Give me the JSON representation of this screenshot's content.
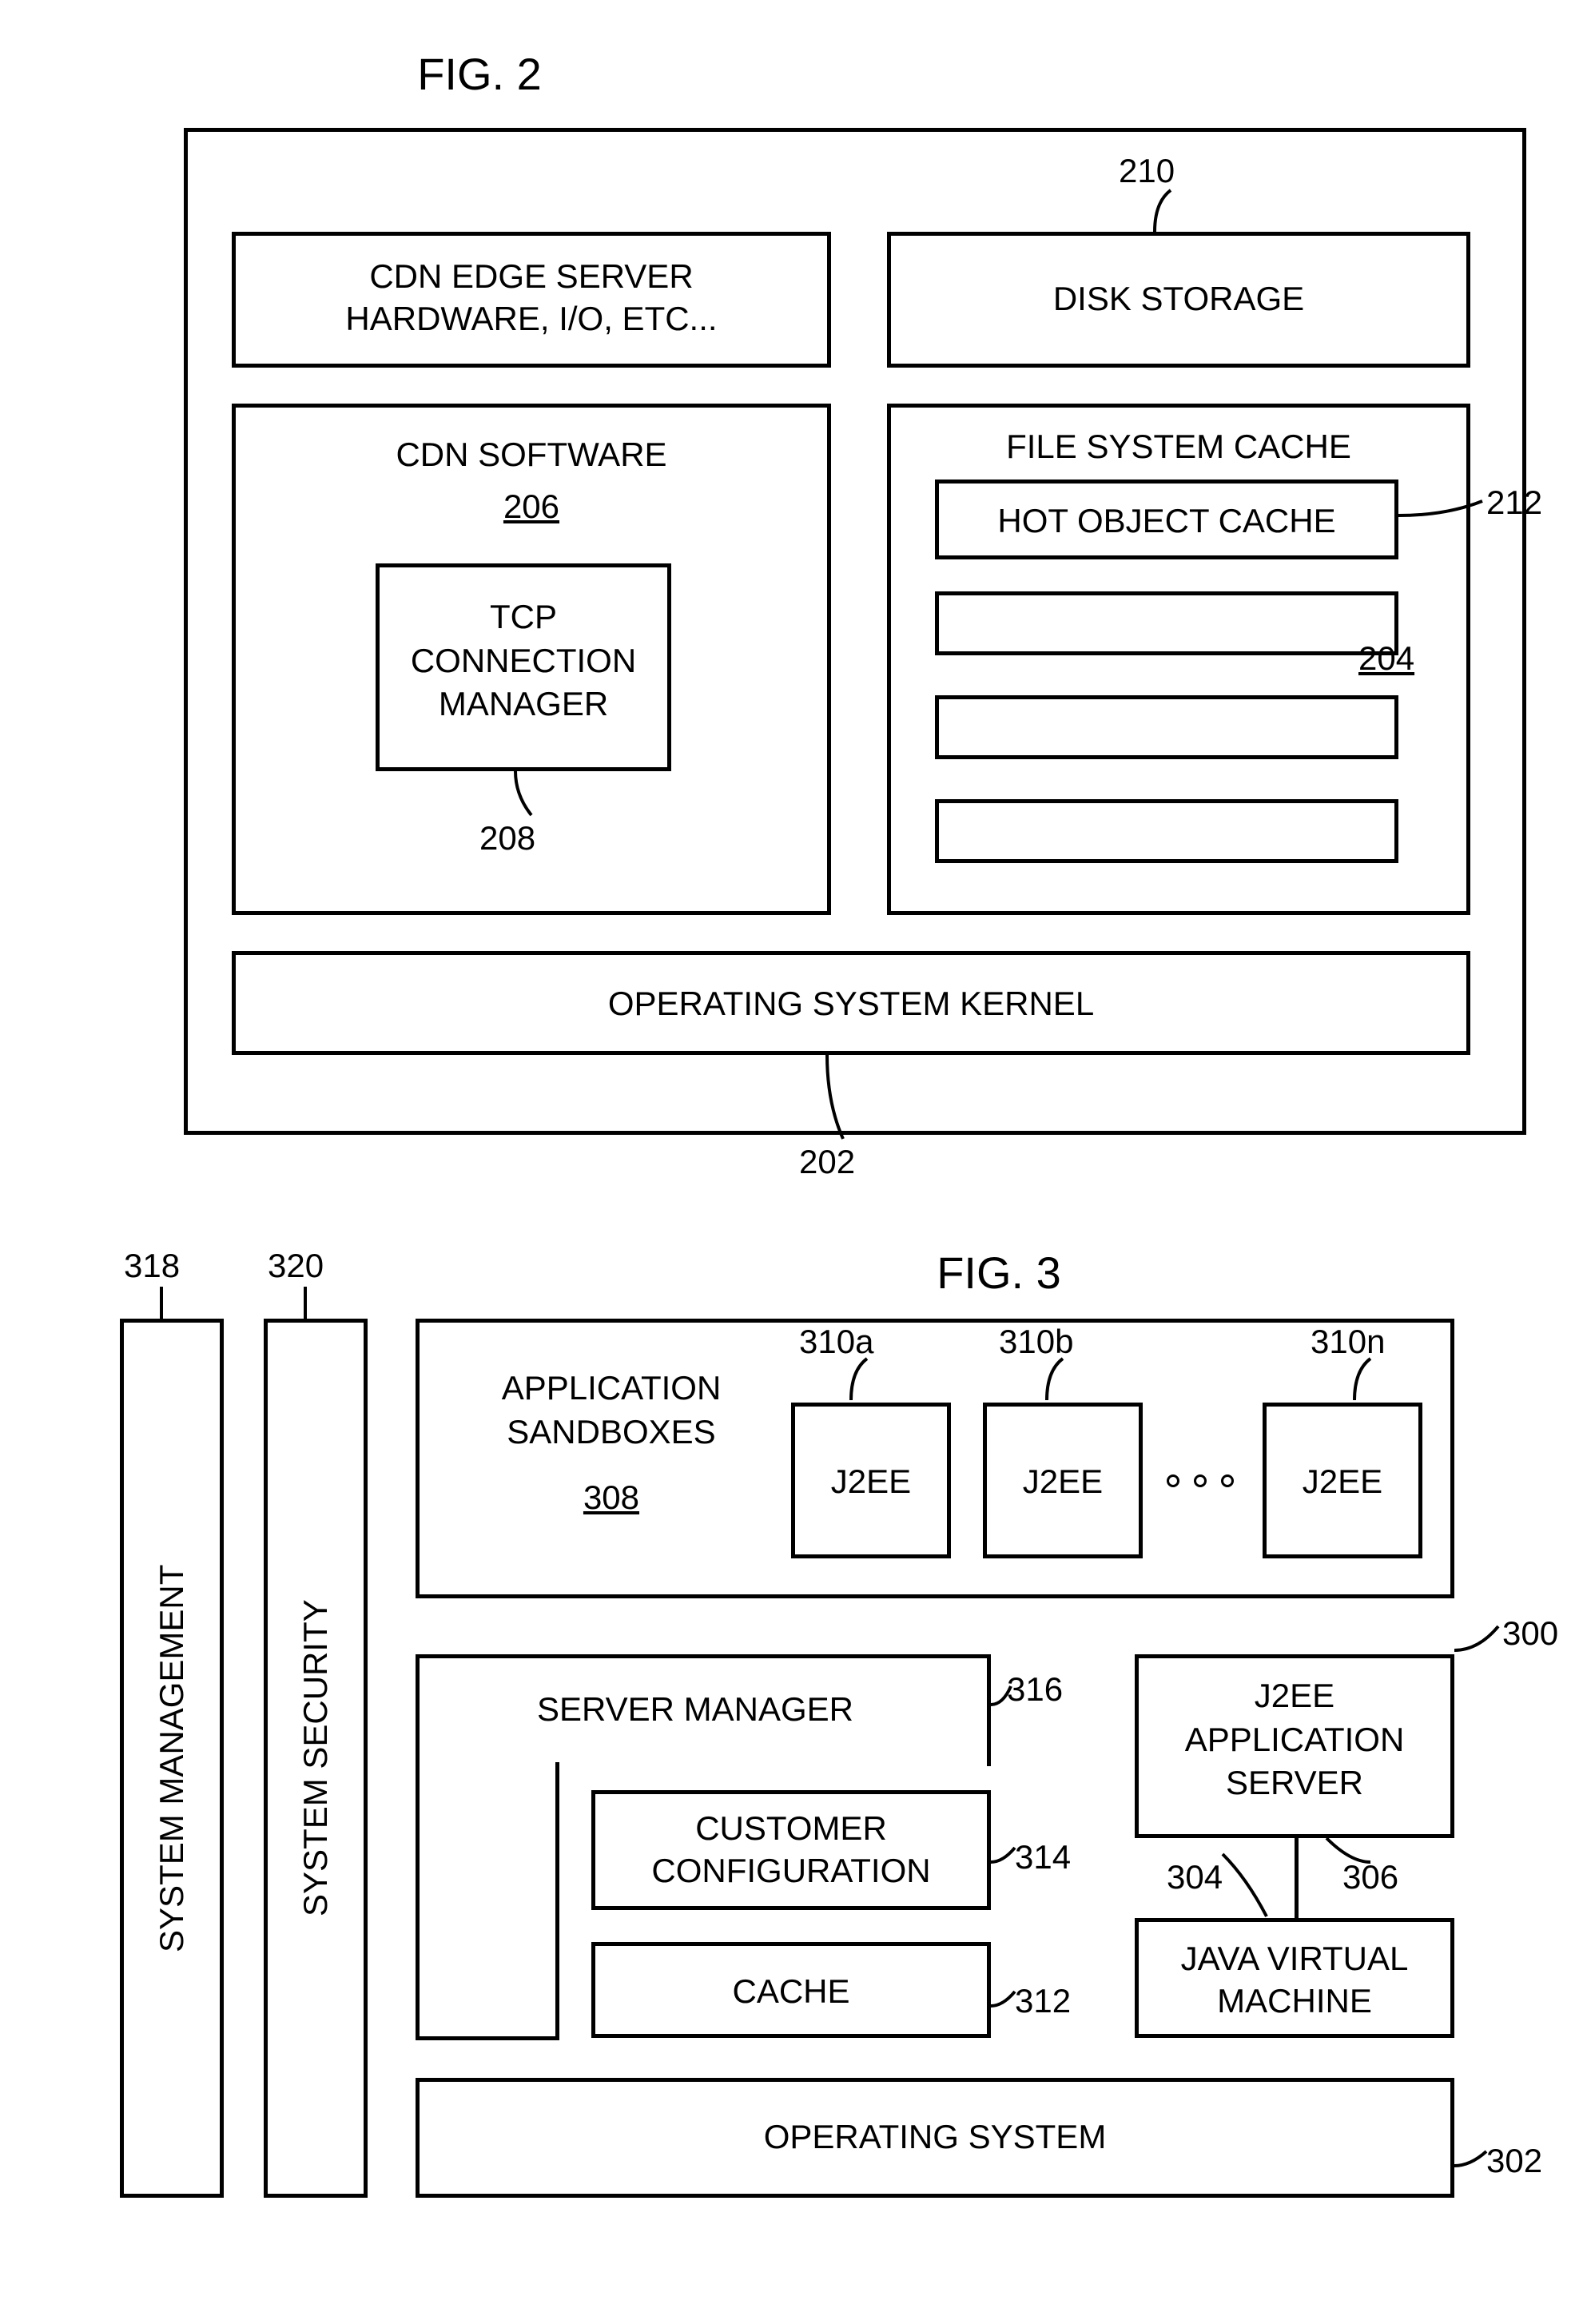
{
  "fig2": {
    "title": "FIG. 2",
    "outer": "",
    "hw": "CDN EDGE SERVER\nHARDWARE, I/O, ETC...",
    "disk": "DISK STORAGE",
    "cdnsoft": "CDN SOFTWARE",
    "cdnsoft_ref": "206",
    "tcp": "TCP\nCONNECTION\nMANAGER",
    "tcp_ref": "208",
    "fsc": "FILE SYSTEM CACHE",
    "hot": "HOT OBJECT CACHE",
    "hot_ref": "212",
    "fsc_ref": "204",
    "disk_ref": "210",
    "kernel": "OPERATING SYSTEM KERNEL",
    "kernel_ref": "202"
  },
  "fig3": {
    "title": "FIG. 3",
    "sysmgmt": "SYSTEM MANAGEMENT",
    "sysmgmt_ref": "318",
    "syssec": "SYSTEM SECURITY",
    "syssec_ref": "320",
    "sandboxes": "APPLICATION\nSANDBOXES",
    "sandboxes_ref": "308",
    "j2ee": "J2EE",
    "j2ee_a_ref": "310a",
    "j2ee_b_ref": "310b",
    "j2ee_n_ref": "310n",
    "group_ref": "300",
    "srvmgr": "SERVER MANAGER",
    "srvmgr_ref": "316",
    "appsrv": "J2EE\nAPPLICATION\nSERVER",
    "appsrv_ref": "306",
    "jvm_ref": "304",
    "custcfg": "CUSTOMER\nCONFIGURATION",
    "custcfg_ref": "314",
    "cache": "CACHE",
    "cache_ref": "312",
    "jvm": "JAVA VIRTUAL\nMACHINE",
    "os": "OPERATING SYSTEM",
    "os_ref": "302"
  }
}
